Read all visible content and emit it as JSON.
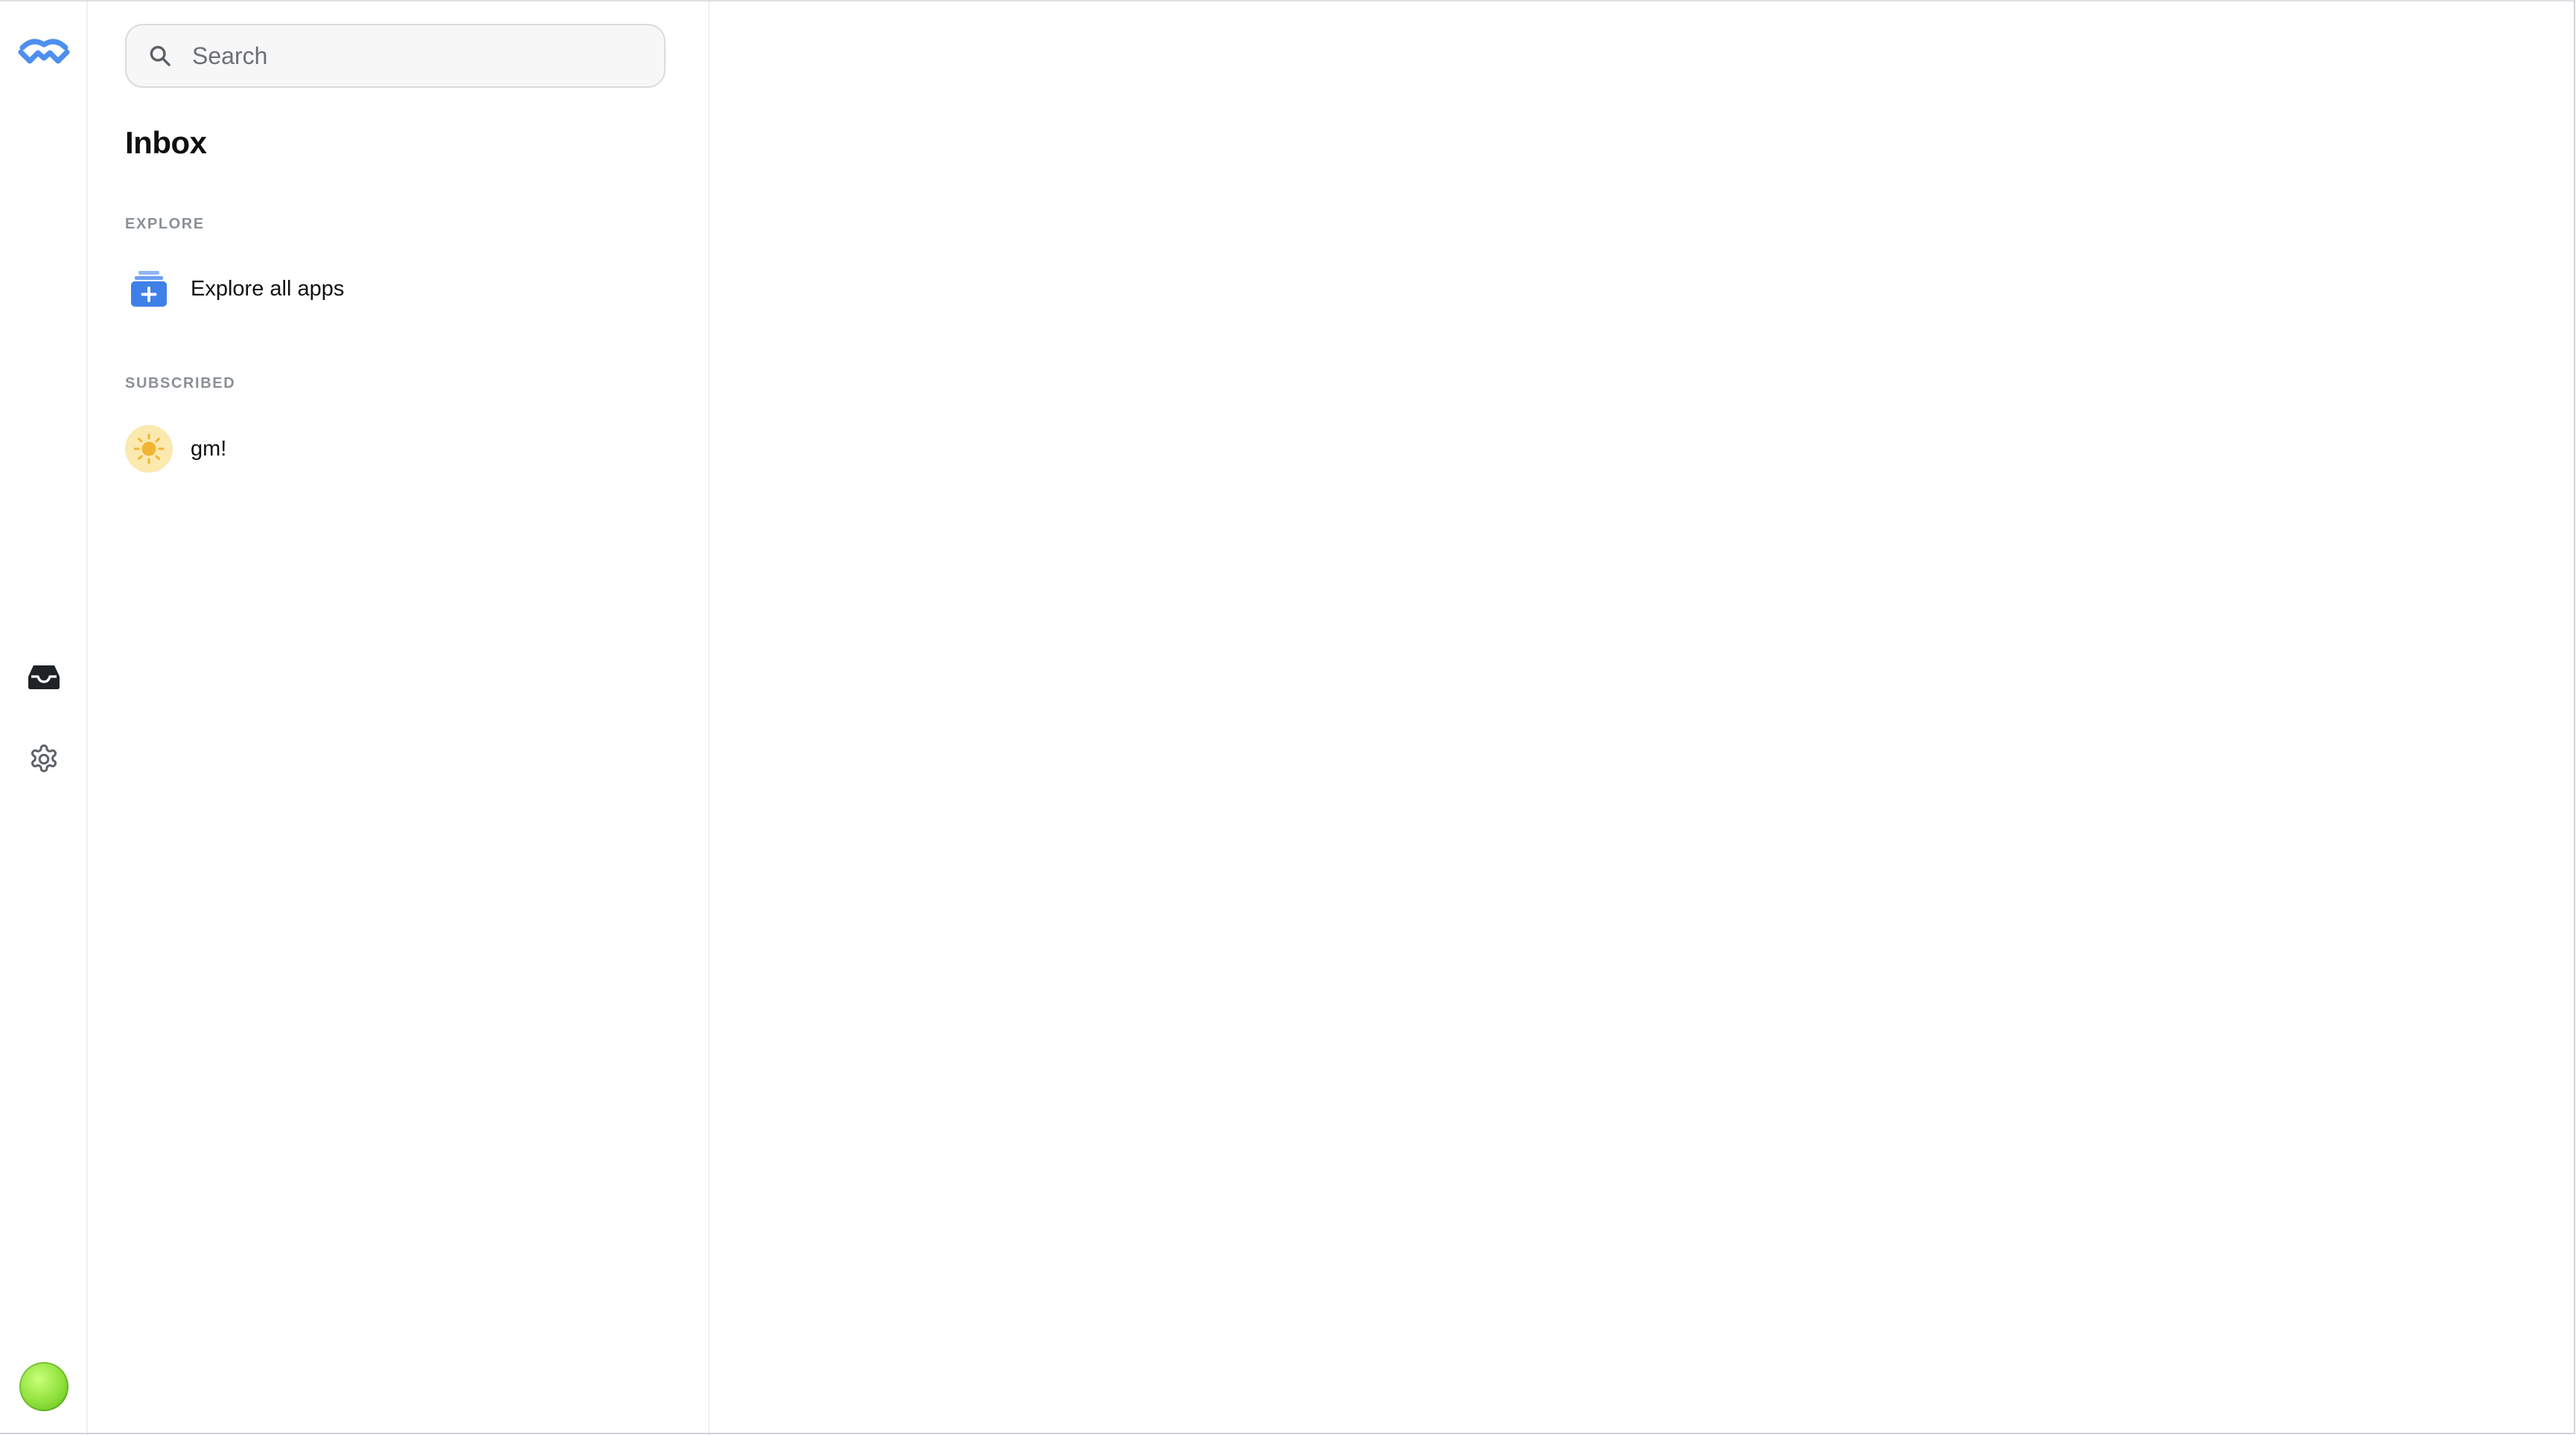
{
  "rail": {
    "logo_icon": "walletconnect-logo-icon",
    "nav": [
      {
        "id": "inbox",
        "icon": "inbox-tray-icon",
        "active": true
      },
      {
        "id": "settings",
        "icon": "gear-icon",
        "active": false
      }
    ],
    "avatar_color": "#8ee03a"
  },
  "panel": {
    "search": {
      "placeholder": "Search",
      "value": ""
    },
    "title": "Inbox",
    "explore": {
      "label": "EXPLORE",
      "items": [
        {
          "label": "Explore all apps",
          "icon": "apps-stack-plus-icon"
        }
      ]
    },
    "subscribed": {
      "label": "SUBSCRIBED",
      "items": [
        {
          "label": "gm!",
          "icon": "sun-icon"
        }
      ]
    }
  },
  "colors": {
    "accent": "#4d8ef0",
    "muted_text": "#8a9095",
    "sun_bg": "#fbe9b0",
    "sun": "#f2b532"
  }
}
